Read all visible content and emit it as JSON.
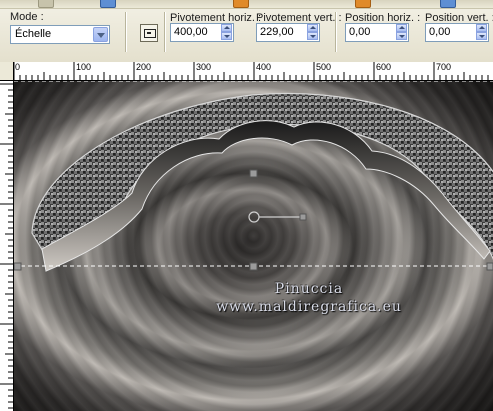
{
  "toolbar": {
    "mode_label": "Mode :",
    "mode_value": "Échelle",
    "pivot_h_label": "Pivotement horiz. :",
    "pivot_h_value": "400,00",
    "pivot_v_label": "Pivotement vert. :",
    "pivot_v_value": "229,00",
    "pos_h_label": "Position horiz. :",
    "pos_h_value": "0,00",
    "pos_v_label": "Position vert. :",
    "pos_v_value": "0,00"
  },
  "ruler": {
    "h_labels": [
      "0",
      "100",
      "200",
      "300",
      "400",
      "500",
      "600",
      "700"
    ]
  },
  "watermark": {
    "line1": "Pinuccia",
    "line2": "www.maldiregrafica.eu"
  }
}
